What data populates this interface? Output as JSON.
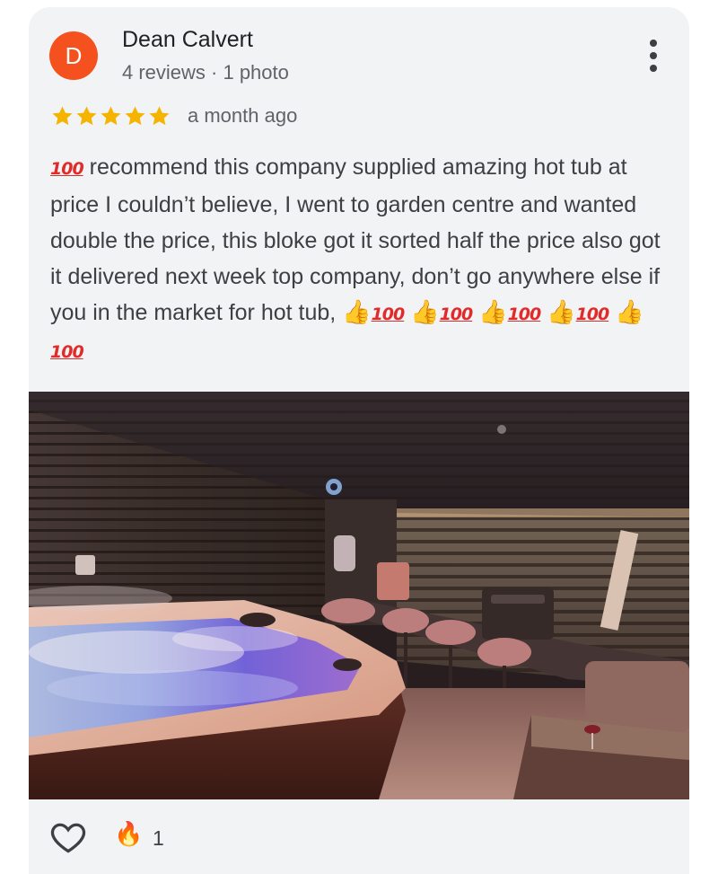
{
  "review": {
    "reviewer_name": "Dean Calvert",
    "avatar_initial": "D",
    "reviewer_meta": "4 reviews · 1 photo",
    "rating": 5,
    "date": "a month ago",
    "text_parts": [
      "recommend this company supplied amazing hot tub at price I couldn’t believe, I went to garden centre and wanted double the price, this bloke got it sorted half the price also got it delivered next week top company, don’t go anywhere else if you in the market for hot tub,"
    ],
    "emoji_hundred": "100",
    "emoji_thumb": "👍"
  },
  "reactions": {
    "fire_count": "1",
    "fire_emoji": "🔥"
  },
  "colors": {
    "avatar": "#f5511e",
    "star": "#f4b400",
    "card_bg": "#f2f3f5"
  }
}
